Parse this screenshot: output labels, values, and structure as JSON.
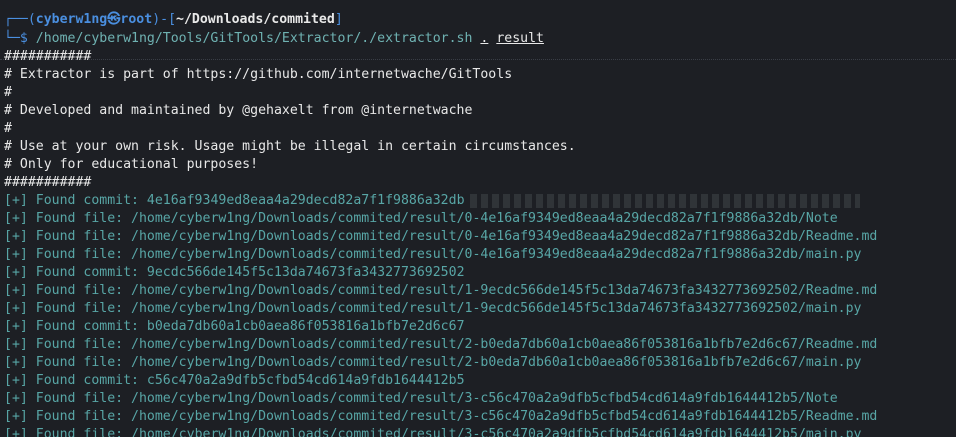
{
  "prompt": {
    "top_left": "┌──(",
    "user": "cyberw1ng",
    "skull": "㉿",
    "host": "root",
    "mid": ")-[",
    "path": "~/Downloads/commited",
    "end": "]",
    "cmd_prefix": "└─$ ",
    "command": "/home/cyberw1ng/Tools/GitTools/Extractor/./extractor.sh",
    "arg1": ".",
    "arg2": "result"
  },
  "banner": [
    "###########",
    "# Extractor is part of https://github.com/internetwache/GitTools",
    "#",
    "# Developed and maintained by @gehaxelt from @internetwache",
    "#",
    "# Use at your own risk. Usage might be illegal in certain circumstances.",
    "# Only for educational purposes!",
    "###########"
  ],
  "output": [
    {
      "tag": "[+] Found commit: ",
      "value": "4e16af9349ed8eaa4a29decd82a7f1f9886a32db"
    },
    {
      "tag": "[+] Found file: ",
      "value": "/home/cyberw1ng/Downloads/commited/result/0-4e16af9349ed8eaa4a29decd82a7f1f9886a32db/Note"
    },
    {
      "tag": "[+] Found file: ",
      "value": "/home/cyberw1ng/Downloads/commited/result/0-4e16af9349ed8eaa4a29decd82a7f1f9886a32db/Readme.md"
    },
    {
      "tag": "[+] Found file: ",
      "value": "/home/cyberw1ng/Downloads/commited/result/0-4e16af9349ed8eaa4a29decd82a7f1f9886a32db/main.py"
    },
    {
      "tag": "[+] Found commit: ",
      "value": "9ecdc566de145f5c13da74673fa3432773692502"
    },
    {
      "tag": "[+] Found file: ",
      "value": "/home/cyberw1ng/Downloads/commited/result/1-9ecdc566de145f5c13da74673fa3432773692502/Readme.md"
    },
    {
      "tag": "[+] Found file: ",
      "value": "/home/cyberw1ng/Downloads/commited/result/1-9ecdc566de145f5c13da74673fa3432773692502/main.py"
    },
    {
      "tag": "[+] Found commit: ",
      "value": "b0eda7db60a1cb0aea86f053816a1bfb7e2d6c67"
    },
    {
      "tag": "[+] Found file: ",
      "value": "/home/cyberw1ng/Downloads/commited/result/2-b0eda7db60a1cb0aea86f053816a1bfb7e2d6c67/Readme.md"
    },
    {
      "tag": "[+] Found file: ",
      "value": "/home/cyberw1ng/Downloads/commited/result/2-b0eda7db60a1cb0aea86f053816a1bfb7e2d6c67/main.py"
    },
    {
      "tag": "[+] Found commit: ",
      "value": "c56c470a2a9dfb5cfbd54cd614a9fdb1644412b5"
    },
    {
      "tag": "[+] Found file: ",
      "value": "/home/cyberw1ng/Downloads/commited/result/3-c56c470a2a9dfb5cfbd54cd614a9fdb1644412b5/Note"
    },
    {
      "tag": "[+] Found file: ",
      "value": "/home/cyberw1ng/Downloads/commited/result/3-c56c470a2a9dfb5cfbd54cd614a9fdb1644412b5/Readme.md"
    },
    {
      "tag": "[+] Found file: ",
      "value": "/home/cyberw1ng/Downloads/commited/result/3-c56c470a2a9dfb5cfbd54cd614a9fdb1644412b5/main.py"
    }
  ]
}
